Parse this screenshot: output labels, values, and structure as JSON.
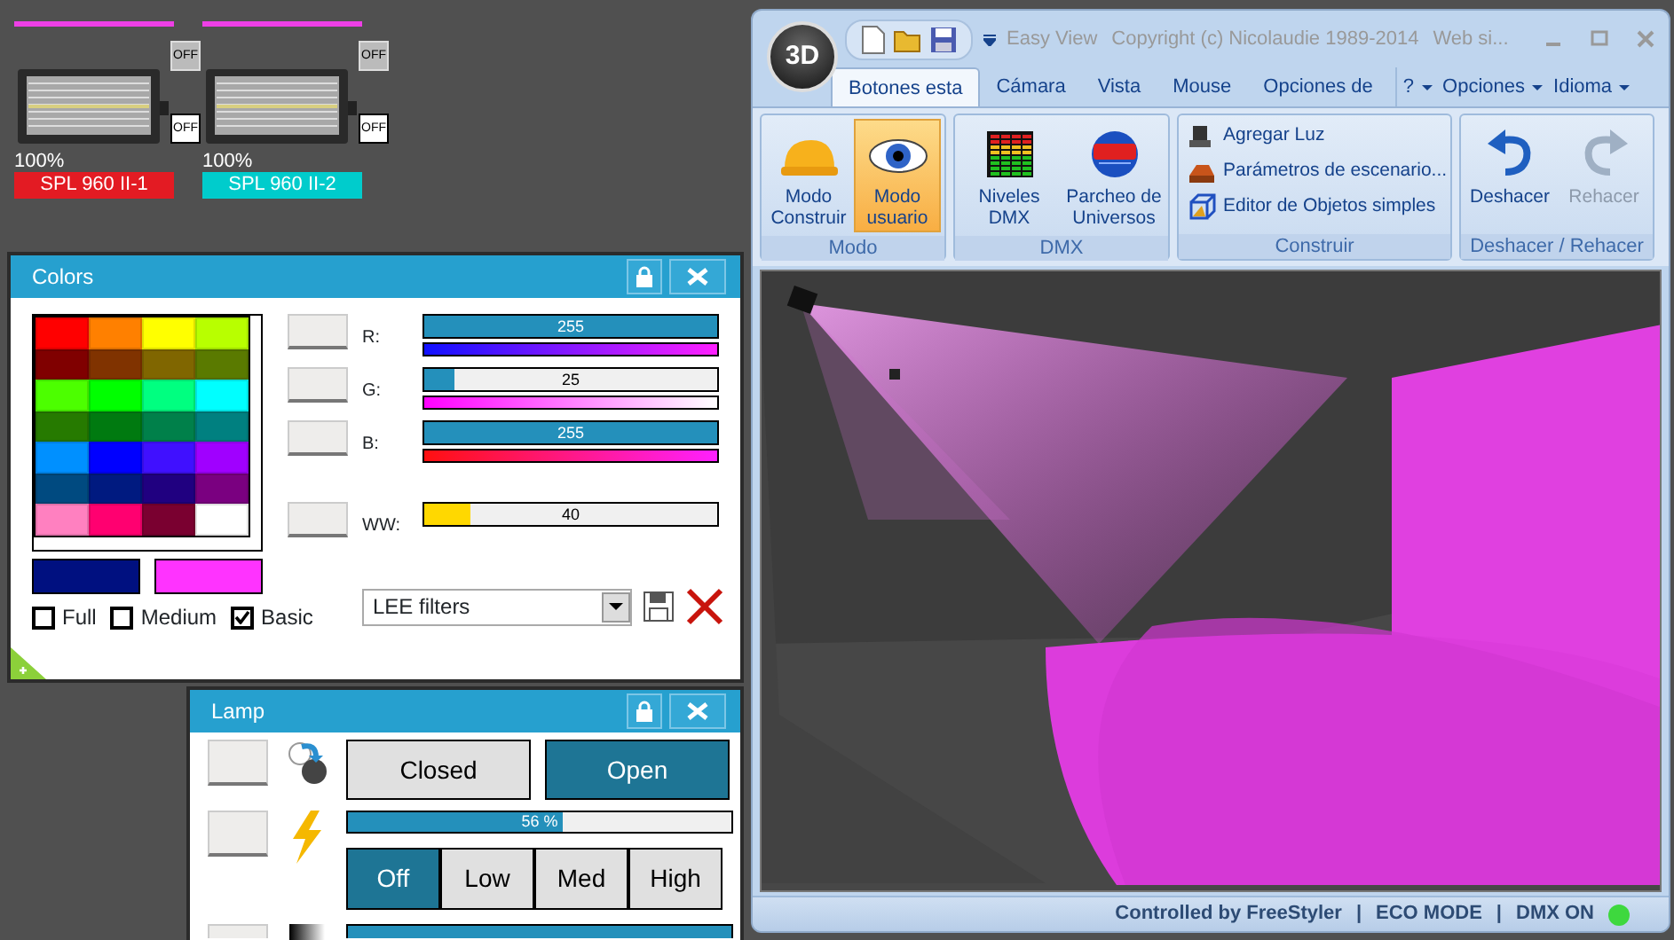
{
  "fixtures": [
    {
      "off_buttons": [
        "OFF",
        "OFF"
      ],
      "intensity": "100%",
      "name": "SPL 960 II-1",
      "color": "#e31b23"
    },
    {
      "off_buttons": [
        "OFF",
        "OFF"
      ],
      "intensity": "100%",
      "name": "SPL 960 II-2",
      "color": "#00cccc"
    }
  ],
  "colors_panel": {
    "title": "Colors",
    "palette": [
      {
        "color": "#ff0000"
      },
      {
        "color": "#ff8000"
      },
      {
        "color": "#ffff00"
      },
      {
        "color": "#b8ff00"
      },
      {
        "color": "#800000"
      },
      {
        "color": "#803300"
      },
      {
        "color": "#806600"
      },
      {
        "color": "#5a7a00"
      },
      {
        "color": "#4cff00"
      },
      {
        "color": "#00ff00"
      },
      {
        "color": "#00ff80"
      },
      {
        "color": "#00ffff"
      },
      {
        "color": "#267a00"
      },
      {
        "color": "#007a10"
      },
      {
        "color": "#00804a"
      },
      {
        "color": "#008080"
      },
      {
        "color": "#0090ff"
      },
      {
        "color": "#0000ff"
      },
      {
        "color": "#4010ff"
      },
      {
        "color": "#a000ff"
      },
      {
        "color": "#004a80"
      },
      {
        "color": "#001a80"
      },
      {
        "color": "#200080"
      },
      {
        "color": "#7a0080"
      },
      {
        "color": "#ff80c0"
      },
      {
        "color": "#ff0070"
      },
      {
        "color": "#7a0030"
      },
      {
        "color": "#ffffff"
      }
    ],
    "channels": [
      {
        "kind": "rgb",
        "label": "R:",
        "value": "255",
        "level": 1
      },
      {
        "kind": "rgb",
        "label": "G:",
        "value": "25",
        "level": 0.1
      },
      {
        "kind": "rgb",
        "label": "B:",
        "value": "255",
        "level": 1
      },
      {
        "kind": "white",
        "label": "WW:",
        "value": "40",
        "level": 0.16
      }
    ],
    "current_colors": [
      {
        "color": "#001080"
      },
      {
        "color": "#ff33ff"
      }
    ],
    "modes": [
      {
        "label": "Full",
        "checked": false
      },
      {
        "label": "Medium",
        "checked": false
      },
      {
        "label": "Basic",
        "checked": true
      }
    ],
    "filter_select": {
      "value": "LEE filters"
    }
  },
  "lamp_panel": {
    "title": "Lamp",
    "shutter": [
      {
        "label": "Closed",
        "selected": false
      },
      {
        "label": "Open",
        "selected": true
      }
    ],
    "dimmer": {
      "value": "56 %",
      "level": 0.56
    },
    "power": [
      {
        "label": "Off",
        "selected": true
      },
      {
        "label": "Low",
        "selected": false
      },
      {
        "label": "Med",
        "selected": false
      },
      {
        "label": "High",
        "selected": false
      }
    ],
    "third_bar": {
      "level": 1
    }
  },
  "app_window": {
    "orb_label": "3D",
    "title_parts": [
      "Easy View",
      "Copyright (c) Nicolaudie 1989-2014",
      "Web si..."
    ],
    "tabs": [
      {
        "label": "Botones esta",
        "selected": true
      },
      {
        "label": "Cámara",
        "selected": false
      },
      {
        "label": "Vista",
        "selected": false
      },
      {
        "label": "Mouse",
        "selected": false
      },
      {
        "label": "Opciones de",
        "selected": false
      }
    ],
    "menus": [
      {
        "label": "?"
      },
      {
        "label": "Opciones"
      },
      {
        "label": "Idioma"
      }
    ],
    "groups": [
      {
        "label": "Modo",
        "kind": "large",
        "items": [
          {
            "label": "Modo Construir",
            "selected": false,
            "disabled": false
          },
          {
            "label": "Modo usuario",
            "selected": true,
            "disabled": false
          }
        ]
      },
      {
        "label": "DMX",
        "kind": "large",
        "items": [
          {
            "label": "Niveles DMX",
            "selected": false,
            "disabled": false
          },
          {
            "label": "Parcheo de Universos",
            "selected": false,
            "disabled": false
          }
        ]
      },
      {
        "label": "Construir",
        "kind": "small",
        "items": [
          {
            "label": "Agregar Luz"
          },
          {
            "label": "Parámetros de escenario..."
          },
          {
            "label": "Editor de Objetos simples"
          }
        ]
      },
      {
        "label": "Deshacer / Rehacer",
        "kind": "large",
        "items": [
          {
            "label": "Deshacer",
            "selected": false,
            "disabled": false
          },
          {
            "label": "Rehacer",
            "selected": false,
            "disabled": true
          }
        ]
      }
    ],
    "status": [
      "Controlled by FreeStyler",
      "|",
      "ECO MODE",
      "|",
      "DMX ON"
    ],
    "dmx_on": true
  }
}
